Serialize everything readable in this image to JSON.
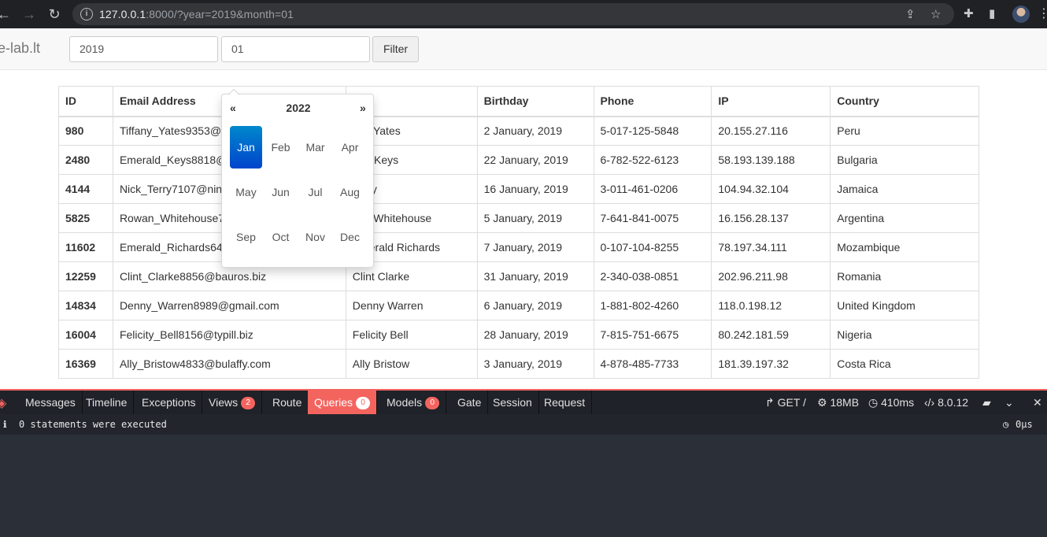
{
  "browser": {
    "url_host": "127.0.0.1",
    "url_rest": ":8000/?year=2019&month=01"
  },
  "app": {
    "brand": "e-lab.lt",
    "year_value": "2019",
    "month_value": "01",
    "filter_label": "Filter"
  },
  "table": {
    "headers": [
      "ID",
      "Email Address",
      "me",
      "Birthday",
      "Phone",
      "IP",
      "Country"
    ],
    "rows": [
      {
        "id": "980",
        "email": "Tiffany_Yates9353@",
        "name": "any Yates",
        "birthday": "2 January, 2019",
        "phone": "5-017-125-5848",
        "ip": "20.155.27.116",
        "country": "Peru"
      },
      {
        "id": "2480",
        "email": "Emerald_Keys8818@",
        "name": "rald Keys",
        "birthday": "22 January, 2019",
        "phone": "6-782-522-6123",
        "ip": "58.193.139.188",
        "country": "Bulgaria"
      },
      {
        "id": "4144",
        "email": "Nick_Terry7107@nin",
        "name": "Terry",
        "birthday": "16 January, 2019",
        "phone": "3-011-461-0206",
        "ip": "104.94.32.104",
        "country": "Jamaica"
      },
      {
        "id": "5825",
        "email": "Rowan_Whitehouse7",
        "name": "van Whitehouse",
        "birthday": "5 January, 2019",
        "phone": "7-641-841-0075",
        "ip": "16.156.28.137",
        "country": "Argentina"
      },
      {
        "id": "11602",
        "email": "Emerald_Richards6439@cispeto.com",
        "name": "Emerald Richards",
        "birthday": "7 January, 2019",
        "phone": "0-107-104-8255",
        "ip": "78.197.34.111",
        "country": "Mozambique"
      },
      {
        "id": "12259",
        "email": "Clint_Clarke8856@bauros.biz",
        "name": "Clint Clarke",
        "birthday": "31 January, 2019",
        "phone": "2-340-038-0851",
        "ip": "202.96.211.98",
        "country": "Romania"
      },
      {
        "id": "14834",
        "email": "Denny_Warren8989@gmail.com",
        "name": "Denny Warren",
        "birthday": "6 January, 2019",
        "phone": "1-881-802-4260",
        "ip": "118.0.198.12",
        "country": "United Kingdom"
      },
      {
        "id": "16004",
        "email": "Felicity_Bell8156@typill.biz",
        "name": "Felicity Bell",
        "birthday": "28 January, 2019",
        "phone": "7-815-751-6675",
        "ip": "80.242.181.59",
        "country": "Nigeria"
      },
      {
        "id": "16369",
        "email": "Ally_Bristow4833@bulaffy.com",
        "name": "Ally Bristow",
        "birthday": "3 January, 2019",
        "phone": "4-878-485-7733",
        "ip": "181.39.197.32",
        "country": "Costa Rica"
      }
    ]
  },
  "datepicker": {
    "prev": "«",
    "next": "»",
    "year": "2022",
    "months": [
      "Jan",
      "Feb",
      "Mar",
      "Apr",
      "May",
      "Jun",
      "Jul",
      "Aug",
      "Sep",
      "Oct",
      "Nov",
      "Dec"
    ],
    "active_month": "Jan"
  },
  "debugbar": {
    "tabs": [
      {
        "label": "Messages"
      },
      {
        "label": "Timeline"
      },
      {
        "label": "Exceptions"
      },
      {
        "label": "Views",
        "badge": "2"
      },
      {
        "label": "Route"
      },
      {
        "label": "Queries",
        "badge": "0"
      },
      {
        "label": "Models",
        "badge": "0"
      },
      {
        "label": "Gate"
      },
      {
        "label": "Session"
      },
      {
        "label": "Request"
      }
    ],
    "active_tab": "Queries",
    "method": "GET /",
    "memory": "18MB",
    "time": "410ms",
    "version": "8.0.12",
    "status": "0 statements were executed",
    "duration": "0μs",
    "accent": "#f4645f"
  }
}
